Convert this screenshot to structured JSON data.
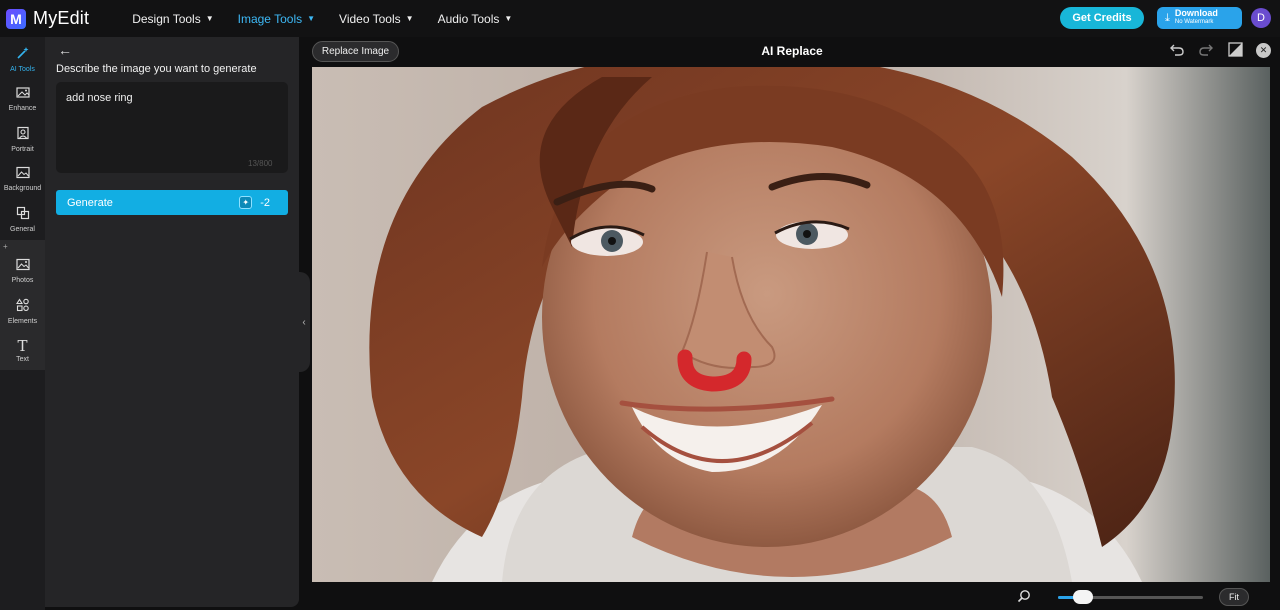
{
  "app": {
    "name": "MyEdit",
    "logo_letter": "M"
  },
  "nav": [
    {
      "label": "Design Tools",
      "active": false
    },
    {
      "label": "Image Tools",
      "active": true
    },
    {
      "label": "Video Tools",
      "active": false
    },
    {
      "label": "Audio Tools",
      "active": false
    }
  ],
  "header": {
    "get_credits": "Get Credits",
    "download_main": "Download",
    "download_sub": "No Watermark",
    "avatar_letter": "D"
  },
  "sidebar": {
    "items": [
      {
        "label": "AI Tools",
        "icon": "magic-wand-icon",
        "active": true
      },
      {
        "label": "Enhance",
        "icon": "enhance-icon",
        "active": false
      },
      {
        "label": "Portrait",
        "icon": "portrait-icon",
        "active": false
      },
      {
        "label": "Background",
        "icon": "background-icon",
        "active": false
      },
      {
        "label": "General",
        "icon": "general-icon",
        "active": false
      },
      {
        "label": "Photos",
        "icon": "photos-icon",
        "active": false
      },
      {
        "label": "Elements",
        "icon": "elements-icon",
        "active": false
      },
      {
        "label": "Text",
        "icon": "text-icon",
        "active": false
      }
    ]
  },
  "panel": {
    "title": "Describe the image you want to generate",
    "prompt_value": "add nose ring",
    "counter": "13/800",
    "generate_label": "Generate",
    "generate_cost": "-2"
  },
  "canvas": {
    "replace_label": "Replace Image",
    "title": "AI Replace",
    "fit_label": "Fit",
    "zoom_level": 0.12
  },
  "colors": {
    "accent": "#12aee3",
    "mask": "#d4282c"
  }
}
